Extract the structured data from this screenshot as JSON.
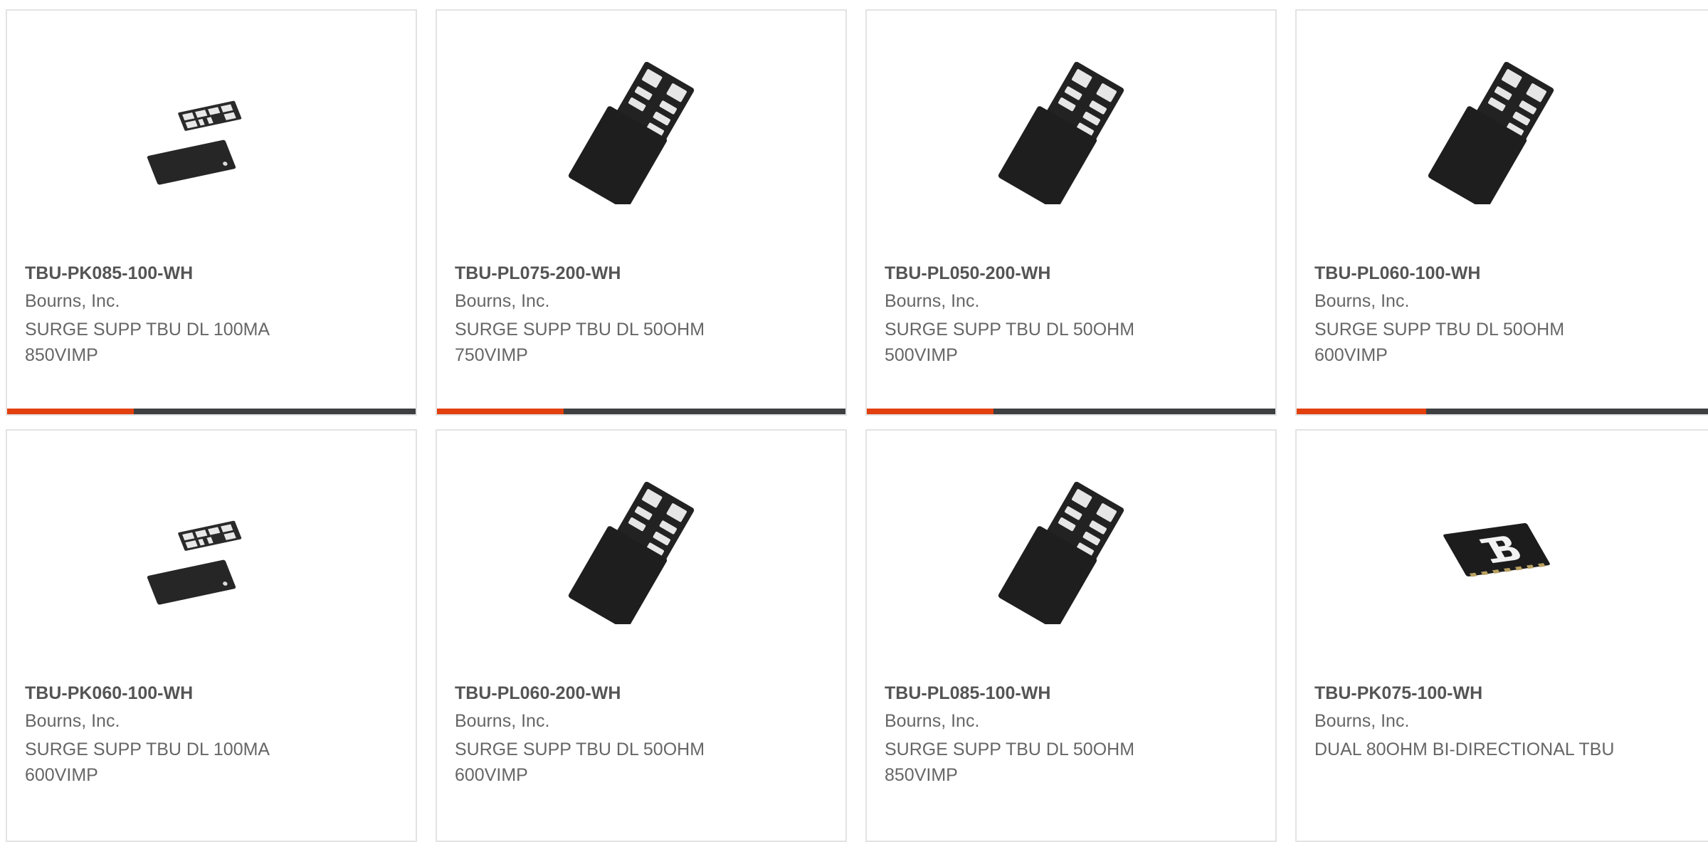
{
  "products": [
    {
      "part_number": "TBU-PK085-100-WH",
      "manufacturer": "Bourns, Inc.",
      "description": "SURGE SUPP TBU DL 100MA 850VIMP",
      "image_icon": "chip-pair-small-icon",
      "progress_fraction": 0.31
    },
    {
      "part_number": "TBU-PL075-200-WH",
      "manufacturer": "Bourns, Inc.",
      "description": "SURGE SUPP TBU DL 50OHM 750VIMP",
      "image_icon": "chip-pair-large-icon",
      "progress_fraction": 0.31
    },
    {
      "part_number": "TBU-PL050-200-WH",
      "manufacturer": "Bourns, Inc.",
      "description": "SURGE SUPP TBU DL 50OHM 500VIMP",
      "image_icon": "chip-pair-large-icon",
      "progress_fraction": 0.31
    },
    {
      "part_number": "TBU-PL060-100-WH",
      "manufacturer": "Bourns, Inc.",
      "description": "SURGE SUPP TBU DL 50OHM 600VIMP",
      "image_icon": "chip-pair-large-icon",
      "progress_fraction": 0.31
    },
    {
      "part_number": "TBU-PK060-100-WH",
      "manufacturer": "Bourns, Inc.",
      "description": "SURGE SUPP TBU DL 100MA 600VIMP",
      "image_icon": "chip-pair-small-icon"
    },
    {
      "part_number": "TBU-PL060-200-WH",
      "manufacturer": "Bourns, Inc.",
      "description": "SURGE SUPP TBU DL 50OHM 600VIMP",
      "image_icon": "chip-pair-large-icon"
    },
    {
      "part_number": "TBU-PL085-100-WH",
      "manufacturer": "Bourns, Inc.",
      "description": "SURGE SUPP TBU DL 50OHM 850VIMP",
      "image_icon": "chip-pair-large-icon"
    },
    {
      "part_number": "TBU-PK075-100-WH",
      "manufacturer": "Bourns, Inc.",
      "description": "DUAL 80OHM BI-DIRECTIONAL TBU",
      "image_icon": "chip-bourns-logo-icon"
    }
  ],
  "colors": {
    "accent": "#e2400e",
    "track": "#3d3f41",
    "border": "#e3e3e3",
    "part_text": "#555555",
    "body_text": "#666666"
  }
}
